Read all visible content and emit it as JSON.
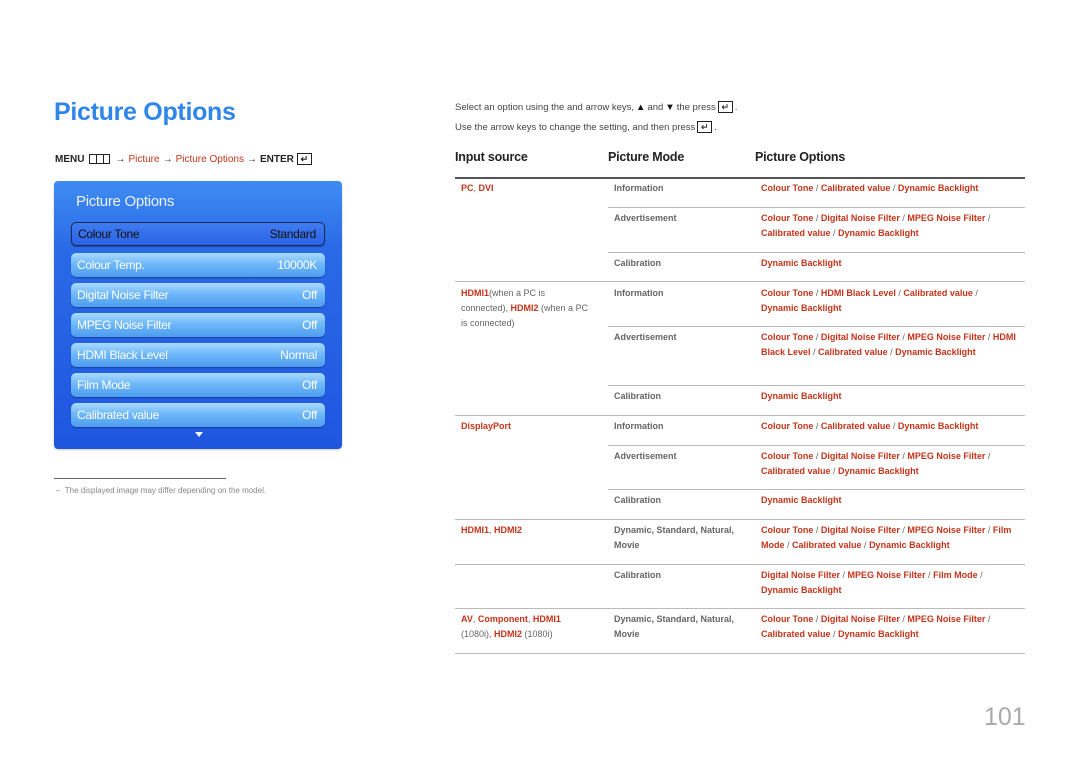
{
  "page": {
    "title": "Picture Options",
    "page_number": "101",
    "footnote": "The displayed image may differ depending on the model.",
    "footnote_dash": "–"
  },
  "breadcrumb": {
    "menu": "MENU",
    "menu_icon": "menu-grid-icon",
    "arrow": "→",
    "items": [
      "Picture",
      "Picture Options"
    ],
    "enter": "ENTER",
    "enter_icon": "enter-key-icon",
    "enter_glyph": "↵"
  },
  "osd": {
    "title": "Picture Options",
    "rows": [
      {
        "label": "Colour Tone",
        "value": "Standard",
        "selected": true
      },
      {
        "label": "Colour Temp.",
        "value": "10000K"
      },
      {
        "label": "Digital Noise Filter",
        "value": "Off"
      },
      {
        "label": "MPEG Noise Filter",
        "value": "Off"
      },
      {
        "label": "HDMI Black Level",
        "value": "Normal"
      },
      {
        "label": "Film Mode",
        "value": "Off"
      },
      {
        "label": "Calibrated value",
        "value": "Off"
      }
    ],
    "scroll_icon": "scroll-down-arrow-icon"
  },
  "instructions": {
    "line1_a": "Select an option using the and arrow keys,",
    "up": "▲",
    "line1_and": "and",
    "down": "▼",
    "line1_b": "the press",
    "line1_end": ".",
    "line2": "Use the arrow keys to change the setting, and then press",
    "line2_end": "."
  },
  "table": {
    "headers": [
      "Input source",
      "Picture Mode",
      "Picture Options"
    ],
    "rows": [
      {
        "source_red": "PC",
        "source_sep": ", ",
        "source_red2": "DVI",
        "mode": "Information",
        "options": [
          "Colour Tone",
          "Calibrated value",
          "Dynamic Backlight"
        ]
      },
      {
        "mode": "Advertisement",
        "options": [
          "Colour Tone",
          "Digital Noise Filter",
          "MPEG Noise Filter",
          "Calibrated value",
          "Dynamic Backlight"
        ]
      },
      {
        "mode": "Calibration",
        "options": [
          "Dynamic Backlight"
        ]
      },
      {
        "source_red": "HDMI1",
        "source_txt": "(when a PC is connected), ",
        "source_red2": "HDMI2",
        "source_txt2": " (when a PC is connected)",
        "mode": "Information",
        "options": [
          "Colour Tone",
          "HDMI Black Level",
          "Calibrated value",
          "Dynamic Backlight"
        ]
      },
      {
        "mode": "Advertisement",
        "options": [
          "Colour Tone",
          "Digital Noise Filter",
          "MPEG Noise Filter",
          "HDMI Black Level",
          "Calibrated value",
          "Dynamic Backlight"
        ]
      },
      {
        "mode": "Calibration",
        "options": [
          "Dynamic Backlight"
        ]
      },
      {
        "source_red": "DisplayPort",
        "mode": "Information",
        "options": [
          "Colour Tone",
          "Calibrated value",
          "Dynamic Backlight"
        ]
      },
      {
        "mode": "Advertisement",
        "options": [
          "Colour Tone",
          "Digital Noise Filter",
          "MPEG Noise Filter",
          "Calibrated value",
          "Dynamic Backlight"
        ]
      },
      {
        "mode": "Calibration",
        "options": [
          "Dynamic Backlight"
        ]
      },
      {
        "source_red": "HDMI1",
        "source_sep": ", ",
        "source_red2": "HDMI2",
        "mode": "Dynamic, Standard, Natural, Movie",
        "options": [
          "Colour Tone",
          "Digital Noise Filter",
          "MPEG Noise Filter",
          "Film Mode",
          "Calibrated value",
          "Dynamic Backlight"
        ]
      },
      {
        "mode": "Calibration",
        "options": [
          "Digital Noise Filter",
          "MPEG Noise Filter",
          "Film Mode",
          "Dynamic Backlight"
        ]
      },
      {
        "source_red": "AV",
        "source_sep": ", ",
        "source_red2": "Component",
        "source_sep2": ", ",
        "source_red3": "HDMI1",
        "source_txt": " (1080i), ",
        "source_red4": "HDMI2",
        "source_txt2": " (1080i)",
        "mode": "Dynamic, Standard, Natural, Movie",
        "options": [
          "Colour Tone",
          "Digital Noise Filter",
          "MPEG Noise Filter",
          "Calibrated value",
          "Dynamic Backlight"
        ]
      }
    ]
  },
  "colors": {
    "title_blue": "#2f86ea",
    "accent_red": "#c5341a",
    "osd_blue": "#1f56e0"
  }
}
